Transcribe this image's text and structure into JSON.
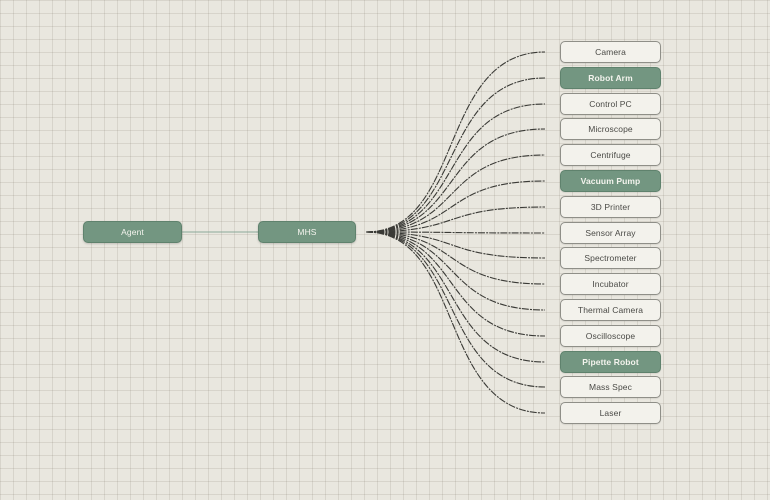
{
  "nodes": {
    "agent": "Agent",
    "hub": "MHS"
  },
  "devices": [
    {
      "label": "Camera",
      "highlight": false
    },
    {
      "label": "Robot Arm",
      "highlight": true
    },
    {
      "label": "Control PC",
      "highlight": false
    },
    {
      "label": "Microscope",
      "highlight": false
    },
    {
      "label": "Centrifuge",
      "highlight": false
    },
    {
      "label": "Vacuum Pump",
      "highlight": true
    },
    {
      "label": "3D Printer",
      "highlight": false
    },
    {
      "label": "Sensor Array",
      "highlight": false
    },
    {
      "label": "Spectrometer",
      "highlight": false
    },
    {
      "label": "Incubator",
      "highlight": false
    },
    {
      "label": "Thermal Camera",
      "highlight": false
    },
    {
      "label": "Oscilloscope",
      "highlight": false
    },
    {
      "label": "Pipette Robot",
      "highlight": true
    },
    {
      "label": "Mass Spec",
      "highlight": false
    },
    {
      "label": "Laser",
      "highlight": false
    }
  ],
  "colors": {
    "accent": "#739681",
    "node_light": "#f3f2ec",
    "connector": "#3a3a36",
    "agent_link": "#8aa898",
    "background": "#e9e7df"
  }
}
